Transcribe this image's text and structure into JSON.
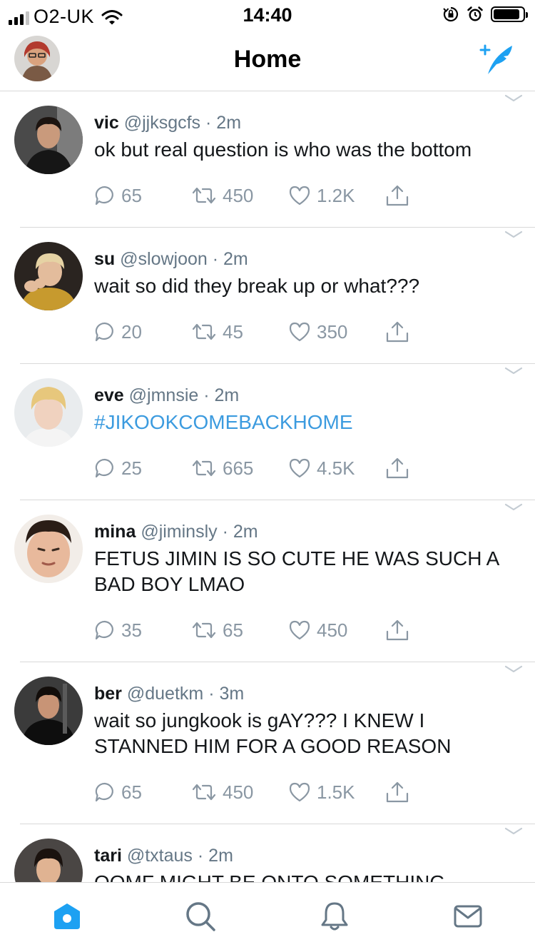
{
  "status_bar": {
    "carrier": "O2-UK",
    "time": "14:40",
    "battery_level": 0.9
  },
  "header": {
    "title": "Home"
  },
  "tweets": [
    {
      "name": "vic",
      "handle": "@jjksgcfs",
      "dot": "·",
      "ago": "2m",
      "text": "ok but real question is who was the bottom",
      "replies": "65",
      "retweets": "450",
      "likes": "1.2K",
      "is_hashtag": false
    },
    {
      "name": "su",
      "handle": "@slowjoon",
      "dot": "·",
      "ago": "2m",
      "text": "wait so did they break up or what???",
      "replies": "20",
      "retweets": "45",
      "likes": "350",
      "is_hashtag": false
    },
    {
      "name": "eve",
      "handle": "@jmnsie",
      "dot": "·",
      "ago": "2m",
      "text": "#JIKOOKCOMEBACKHOME",
      "replies": "25",
      "retweets": "665",
      "likes": "4.5K",
      "is_hashtag": true
    },
    {
      "name": "mina",
      "handle": "@jiminsly",
      "dot": "·",
      "ago": "2m",
      "text": "FETUS JIMIN IS SO CUTE HE WAS SUCH A BAD BOY LMAO",
      "replies": "35",
      "retweets": "65",
      "likes": "450",
      "is_hashtag": false
    },
    {
      "name": "ber",
      "handle": "@duetkm",
      "dot": "·",
      "ago": "3m",
      "text": "wait so jungkook is gAY??? I KNEW I STANNED HIM FOR A GOOD REASON",
      "replies": "65",
      "retweets": "450",
      "likes": "1.5K",
      "is_hashtag": false
    },
    {
      "name": "tari",
      "handle": "@txtaus",
      "dot": "·",
      "ago": "2m",
      "text": "OOMF MIGHT BE ONTO SOMETHING",
      "replies": "",
      "retweets": "",
      "likes": "",
      "is_hashtag": false
    }
  ],
  "tab_bar": [
    "home-icon",
    "search-icon",
    "notifications-icon",
    "messages-icon"
  ],
  "colors": {
    "accent": "#1da1f2",
    "hashtag": "#3c9bdf",
    "muted": "#657786",
    "divider": "#d9d9d9"
  }
}
